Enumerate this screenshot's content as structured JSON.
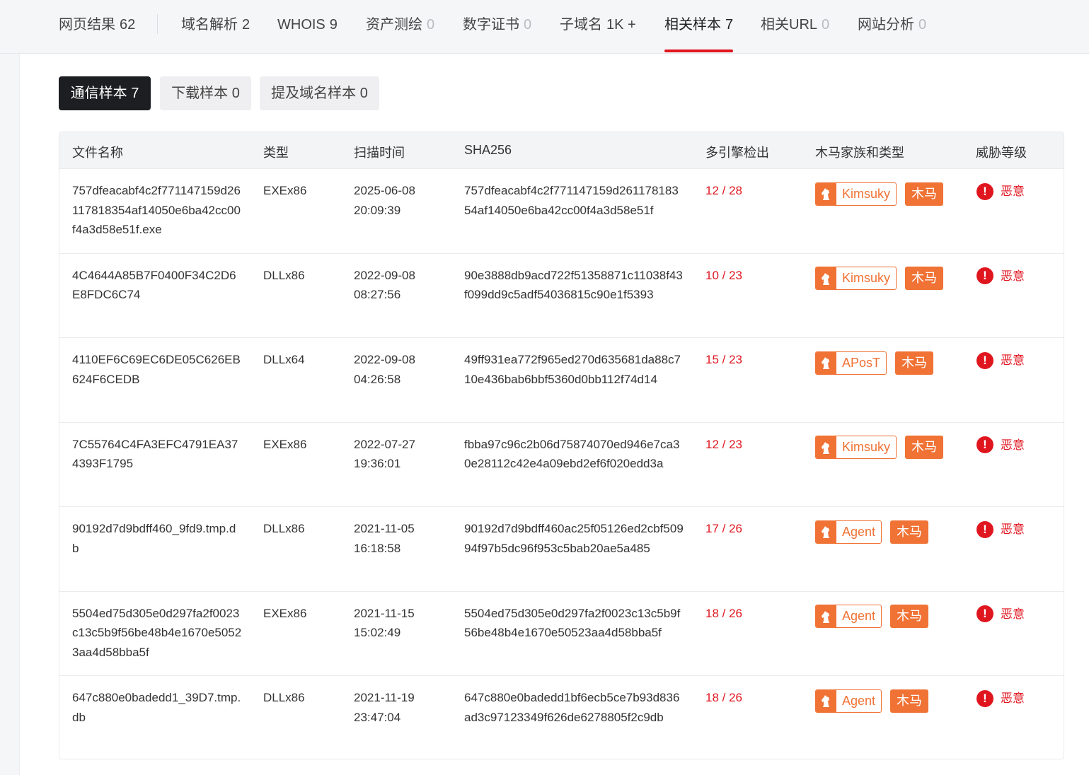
{
  "top_tabs": [
    {
      "label": "网页结果",
      "count": "62"
    },
    {
      "label": "域名解析",
      "count": "2"
    },
    {
      "label": "WHOIS",
      "count": "9"
    },
    {
      "label": "资产测绘",
      "count": "0"
    },
    {
      "label": "数字证书",
      "count": "0"
    },
    {
      "label": "子域名",
      "count": "1K +"
    },
    {
      "label": "相关样本",
      "count": "7"
    },
    {
      "label": "相关URL",
      "count": "0"
    },
    {
      "label": "网站分析",
      "count": "0"
    }
  ],
  "active_top_tab": "相关样本",
  "sub_tabs": [
    {
      "label": "通信样本 7"
    },
    {
      "label": "下载样本 0"
    },
    {
      "label": "提及域名样本 0"
    }
  ],
  "active_sub_tab": "通信样本 7",
  "table": {
    "headers": {
      "name": "文件名称",
      "type": "类型",
      "time": "扫描时间",
      "sha": "SHA256",
      "detect": "多引擎检出",
      "family": "木马家族和类型",
      "threat": "威胁等级"
    },
    "rows": [
      {
        "name": "757dfeacabf4c2f771147159d26117818354af14050e6ba42cc00f4a3d58e51f.exe",
        "type": "EXEx86",
        "date": "2025-06-08",
        "clock": "20:09:39",
        "sha": "757dfeacabf4c2f771147159d26117818354af14050e6ba42cc00f4a3d58e51f",
        "detect": "12 / 28",
        "family": "Kimsuky",
        "category": "木马",
        "threat": "恶意"
      },
      {
        "name": "4C4644A85B7F0400F34C2D6E8FDC6C74",
        "type": "DLLx86",
        "date": "2022-09-08",
        "clock": "08:27:56",
        "sha": "90e3888db9acd722f51358871c11038f43f099dd9c5adf54036815c90e1f5393",
        "detect": "10 / 23",
        "family": "Kimsuky",
        "category": "木马",
        "threat": "恶意"
      },
      {
        "name": "4110EF6C69EC6DE05C626EB624F6CEDB",
        "type": "DLLx64",
        "date": "2022-09-08",
        "clock": "04:26:58",
        "sha": "49ff931ea772f965ed270d635681da88c710e436bab6bbf5360d0bb112f74d14",
        "detect": "15 / 23",
        "family": "APosT",
        "category": "木马",
        "threat": "恶意"
      },
      {
        "name": "7C55764C4FA3EFC4791EA374393F1795",
        "type": "EXEx86",
        "date": "2022-07-27",
        "clock": "19:36:01",
        "sha": "fbba97c96c2b06d75874070ed946e7ca30e28112c42e4a09ebd2ef6f020edd3a",
        "detect": "12 / 23",
        "family": "Kimsuky",
        "category": "木马",
        "threat": "恶意"
      },
      {
        "name": "90192d7d9bdff460_9fd9.tmp.db",
        "type": "DLLx86",
        "date": "2021-11-05",
        "clock": "16:18:58",
        "sha": "90192d7d9bdff460ac25f05126ed2cbf50994f97b5dc96f953c5bab20ae5a485",
        "detect": "17 / 26",
        "family": "Agent",
        "category": "木马",
        "threat": "恶意"
      },
      {
        "name": "5504ed75d305e0d297fa2f0023c13c5b9f56be48b4e1670e50523aa4d58bba5f",
        "type": "EXEx86",
        "date": "2021-11-15",
        "clock": "15:02:49",
        "sha": "5504ed75d305e0d297fa2f0023c13c5b9f56be48b4e1670e50523aa4d58bba5f",
        "detect": "18 / 26",
        "family": "Agent",
        "category": "木马",
        "threat": "恶意"
      },
      {
        "name": "647c880e0badedd1_39D7.tmp.db",
        "type": "DLLx86",
        "date": "2021-11-19",
        "clock": "23:47:04",
        "sha": "647c880e0badedd1bf6ecb5ce7b93d836ad3c97123349f626de6278805f2c9db",
        "detect": "18 / 26",
        "family": "Agent",
        "category": "木马",
        "threat": "恶意"
      }
    ]
  },
  "icons": {
    "family": "trojan-horse-icon",
    "threat": "exclamation-circle-icon"
  },
  "colors": {
    "accent_red": "#e0161f",
    "tag_orange": "#f07234",
    "active_subtab_bg": "#1d1e21"
  }
}
